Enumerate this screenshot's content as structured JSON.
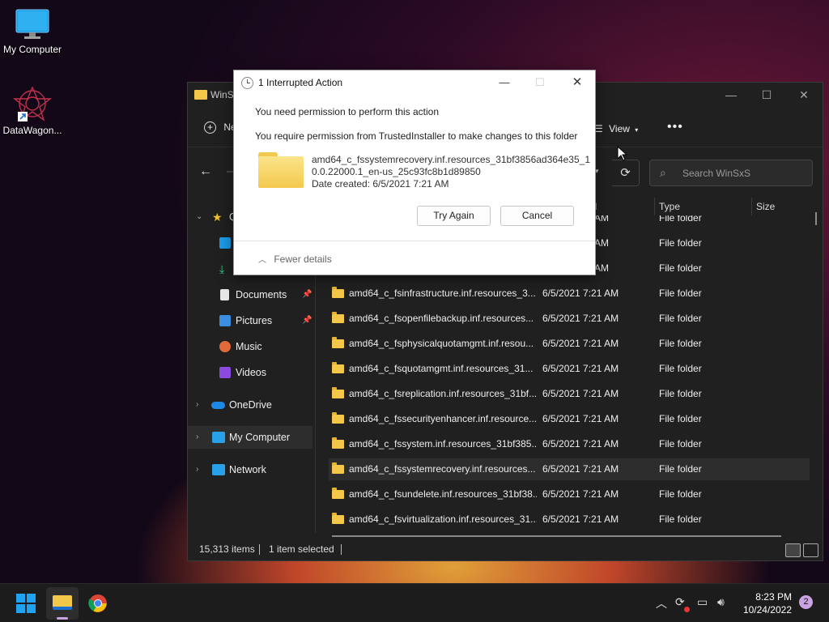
{
  "desktop": {
    "icons": [
      {
        "label": "My Computer",
        "icon": "monitor-icon"
      },
      {
        "label": "DataWagon...",
        "icon": "datawagon-logo-icon"
      }
    ]
  },
  "explorer": {
    "title": "WinSxS",
    "title_partial": "WinS",
    "new_label": "Ne",
    "view_label": "View",
    "search_placeholder": "Search WinSxS",
    "columns": {
      "date": "ed",
      "type": "Type",
      "size": "Size"
    },
    "sidebar": {
      "quick_access_partial": "Q",
      "items": [
        {
          "label": "Documents",
          "pinned": true
        },
        {
          "label": "Pictures",
          "pinned": true
        },
        {
          "label": "Music",
          "pinned": false
        },
        {
          "label": "Videos",
          "pinned": false
        },
        {
          "label": "OneDrive"
        },
        {
          "label": "My Computer",
          "selected": true
        },
        {
          "label": "Network"
        }
      ]
    },
    "files": [
      {
        "name": "",
        "date": "",
        "type": "File folder",
        "partial_date": "21 AM",
        "partial": true
      },
      {
        "name": "",
        "date": "",
        "type": "File folder",
        "partial_date": "21 AM"
      },
      {
        "name": "",
        "date": "",
        "type": "File folder",
        "partial_date": "21 AM"
      },
      {
        "name": "amd64_c_fsinfrastructure.inf.resources_3...",
        "date": "6/5/2021 7:21 AM",
        "type": "File folder"
      },
      {
        "name": "amd64_c_fsopenfilebackup.inf.resources...",
        "date": "6/5/2021 7:21 AM",
        "type": "File folder"
      },
      {
        "name": "amd64_c_fsphysicalquotamgmt.inf.resou...",
        "date": "6/5/2021 7:21 AM",
        "type": "File folder"
      },
      {
        "name": "amd64_c_fsquotamgmt.inf.resources_31...",
        "date": "6/5/2021 7:21 AM",
        "type": "File folder"
      },
      {
        "name": "amd64_c_fsreplication.inf.resources_31bf...",
        "date": "6/5/2021 7:21 AM",
        "type": "File folder"
      },
      {
        "name": "amd64_c_fssecurityenhancer.inf.resource...",
        "date": "6/5/2021 7:21 AM",
        "type": "File folder"
      },
      {
        "name": "amd64_c_fssystem.inf.resources_31bf385...",
        "date": "6/5/2021 7:21 AM",
        "type": "File folder"
      },
      {
        "name": "amd64_c_fssystemrecovery.inf.resources...",
        "date": "6/5/2021 7:21 AM",
        "type": "File folder",
        "selected": true
      },
      {
        "name": "amd64_c_fsundelete.inf.resources_31bf38...",
        "date": "6/5/2021 7:21 AM",
        "type": "File folder"
      },
      {
        "name": "amd64_c_fsvirtualization.inf.resources_31...",
        "date": "6/5/2021 7:21 AM",
        "type": "File folder"
      }
    ],
    "status": {
      "items": "15,313 items",
      "selected": "1 item selected"
    }
  },
  "dialog": {
    "title": "1 Interrupted Action",
    "message1": "You need permission to perform this action",
    "message2": "You require permission from TrustedInstaller to make changes to this folder",
    "file_line1": "amd64_c_fssystemrecovery.inf.resources_31bf3856ad364e35_1",
    "file_line2": "0.0.22000.1_en-us_25c93fc8b1d89850",
    "date_created": "Date created: 6/5/2021 7:21 AM",
    "try_again": "Try Again",
    "cancel": "Cancel",
    "fewer_details": "Fewer details"
  },
  "taskbar": {
    "time": "8:23 PM",
    "date": "10/24/2022",
    "notifications": "2",
    "accent": "#0078d4"
  }
}
